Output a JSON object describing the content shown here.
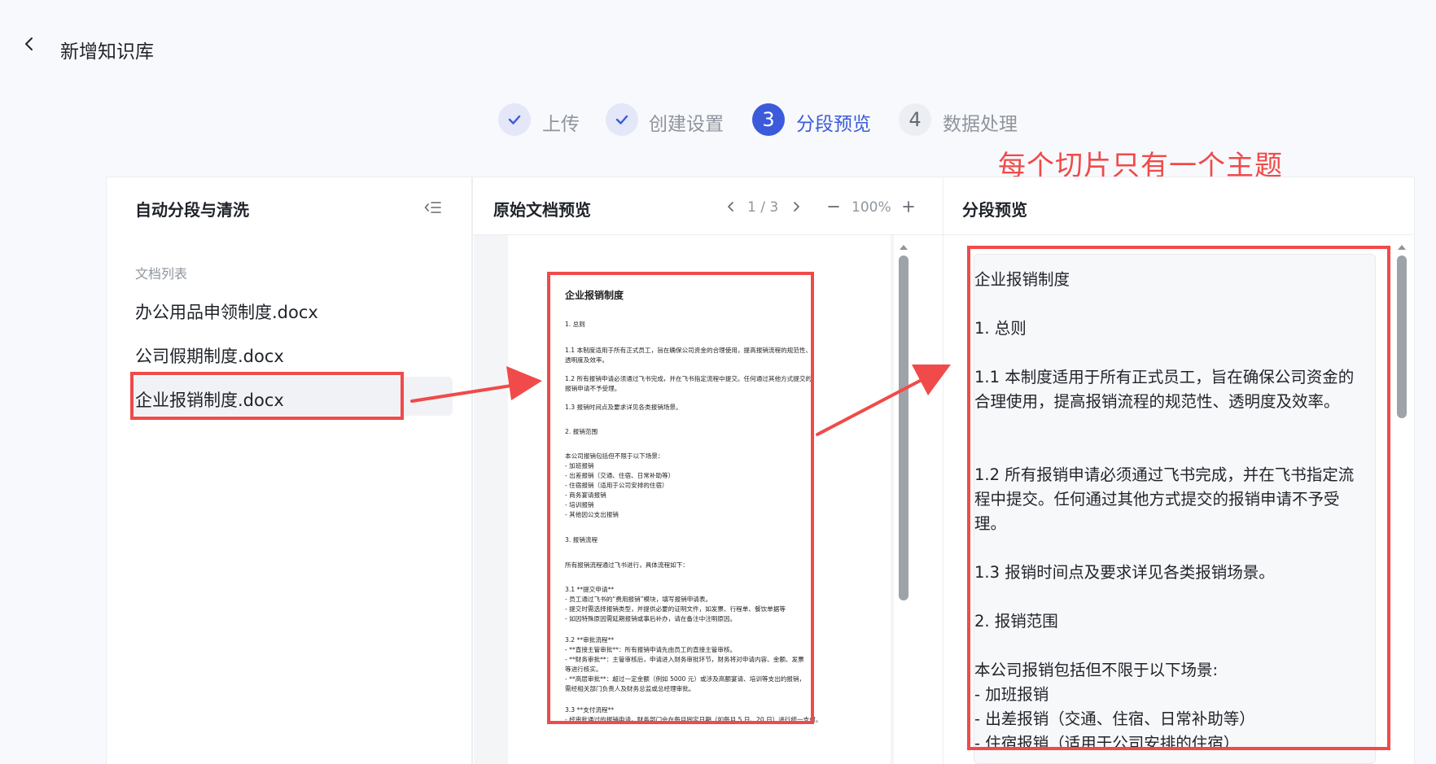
{
  "header": {
    "title": "新增知识库"
  },
  "steps": [
    {
      "label": "上传",
      "state": "done"
    },
    {
      "label": "创建设置",
      "state": "done"
    },
    {
      "number": "3",
      "label": "分段预览",
      "state": "active"
    },
    {
      "number": "4",
      "label": "数据处理",
      "state": "todo"
    }
  ],
  "annotation": "每个切片只有一个主题",
  "left_panel": {
    "title": "自动分段与清洗",
    "doc_list_label": "文档列表",
    "docs": [
      "办公用品申领制度.docx",
      "公司假期制度.docx",
      "企业报销制度.docx"
    ],
    "selected_index": 2
  },
  "middle_panel": {
    "title": "原始文档预览",
    "page_indicator": "1 / 3",
    "zoom": "100%"
  },
  "doc_preview": {
    "lines": [
      "企业报销制度",
      "1. 总则",
      "1.1 本制度适用于所有正式员工，旨在确保公司资金的合理使用，提高报销流程的规范性、",
      "透明度及效率。",
      "1.2 所有报销申请必须通过飞书完成，并在飞书指定流程中提交。任何通过其他方式提交的",
      "报销申请不予受理。",
      "1.3 报销时间点及要求详见各类报销场景。",
      "2. 报销范围",
      "本公司报销包括但不限于以下场景：",
      " - 加班报销",
      " - 出差报销（交通、住宿、日常补助等）",
      " - 住宿报销（适用于公司安排的住宿）",
      " - 商务宴请报销",
      " - 培训报销",
      " - 其他因公支出报销",
      "3. 报销流程",
      "所有报销流程通过飞书进行，具体流程如下：",
      "3.1 **提交申请**",
      " - 员工通过飞书的“费用报销”模块，填写报销申请表。",
      " - 提交时需选择报销类型，并提供必要的证明文件，如发票、行程单、餐饮单据等",
      " - 如因特殊原因需延期报销或事后补办，请在备注中注明原因。",
      "3.2 **审批流程**",
      " - **直接主管审批**：所有报销申请先由员工的直接主管审核。",
      " - **财务审批**：主管审核后，申请进入财务审批环节，财务将对申请内容、金额、发票",
      "等进行核实。",
      " - **高层审批**：超过一定金额（例如 5000 元）或涉及高额宴请、培训等支出的报销，",
      "需经相关部门负责人及财务总监或总经理审批。",
      "3.3 **支付流程**",
      " - 经审批通过的报销申请，财务部门会在每月固定日期（如每月 5 日、20 日）进行统一支付。"
    ]
  },
  "right_panel": {
    "title": "分段预览",
    "segment_paragraphs": [
      "企业报销制度",
      "1. 总则",
      "1.1 本制度适用于所有正式员工，旨在确保公司资金的合理使用，提高报销流程的规范性、透明度及效率。",
      "1.2 所有报销申请必须通过飞书完成，并在飞书指定流程中提交。任何通过其他方式提交的报销申请不予受理。",
      "1.3 报销时间点及要求详见各类报销场景。",
      "2. 报销范围",
      "本公司报销包括但不限于以下场景:\n- 加班报销\n- 出差报销（交通、住宿、日常补助等）\n- 住宿报销（适用于公司安排的住宿）"
    ]
  },
  "colors": {
    "accent": "#3b5bdb",
    "annotation_red": "#f04a4a"
  }
}
